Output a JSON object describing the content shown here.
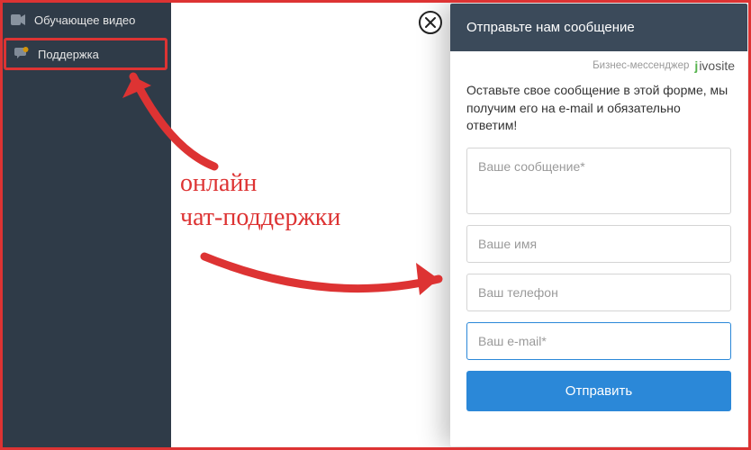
{
  "sidebar": {
    "items": [
      {
        "label": "Обучающее видео",
        "icon": "video-icon"
      },
      {
        "label": "Поддержка",
        "icon": "chat-icon"
      }
    ]
  },
  "closeButton": {
    "aria": "Закрыть"
  },
  "annotation": {
    "line1": "онлайн",
    "line2": "чат-поддержки"
  },
  "chat": {
    "header": "Отправьте нам сообщение",
    "powered_by_prefix": "Бизнес-мессенджер",
    "logo_text_pre": "j",
    "logo_text_post": "ivosite",
    "description": "Оставьте свое сообщение в этой форме, мы получим его на e-mail и обязательно ответим!",
    "fields": {
      "message_placeholder": "Ваше сообщение*",
      "name_placeholder": "Ваше имя",
      "phone_placeholder": "Ваш телефон",
      "email_placeholder": "Ваш e-mail*"
    },
    "send_label": "Отправить"
  },
  "colors": {
    "accent_red": "#d33",
    "accent_blue": "#2b88d8",
    "accent_green": "#55b34d",
    "sidebar_bg": "#2f3b48",
    "chat_header_bg": "#3b4a5a"
  }
}
